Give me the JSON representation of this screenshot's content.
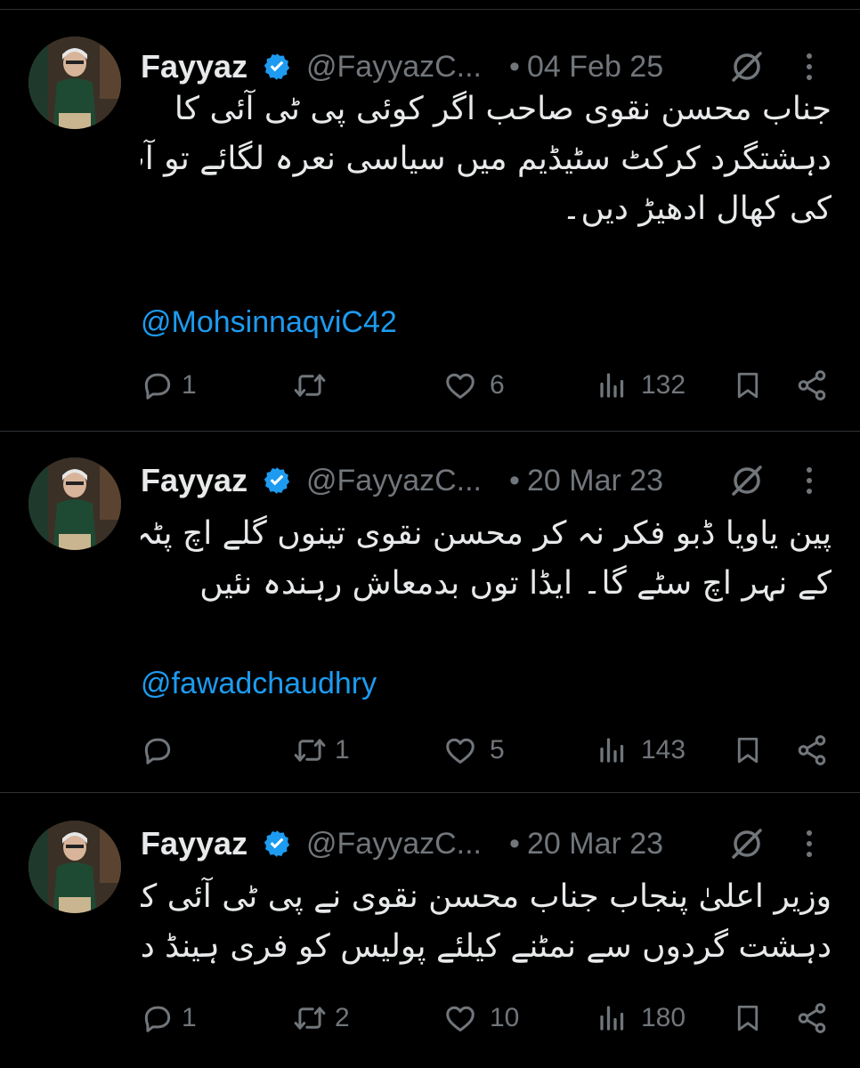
{
  "author": {
    "name": "Fayyaz",
    "handle": "@FayyazC...",
    "verified_color": "#1d9bf0"
  },
  "colors": {
    "background": "#000000",
    "text": "#e7e9ea",
    "muted": "#71767b",
    "link": "#1d9bf0"
  },
  "icons": [
    "verified-badge-icon",
    "grok-icon",
    "more-icon",
    "reply-icon",
    "retweet-icon",
    "like-icon",
    "views-icon",
    "bookmark-icon",
    "share-icon"
  ],
  "tweets": [
    {
      "date": "04 Feb 25",
      "dot": "•",
      "lines": [
        "جناب محسن نقوی صاحب اگر کوئی پی ٹی آئی کا",
        "دہشتگرد کرکٹ سٹیڈیم میں سیاسی نعرہ لگائے تو آپ اس",
        "کی کھال ادھیڑ دیں۔"
      ],
      "mention": "@MohsinnaqviC42",
      "replies": "1",
      "retweets": "",
      "likes": "6",
      "views": "132"
    },
    {
      "date": "20 Mar 23",
      "dot": "•",
      "lines": [
        "پین یاویا ڈبو فکر نہ کر محسن نقوی تینوں گلے اچ پٹہ پا",
        "کے نہر اچ سٹے گا۔ ایڈا توں بدمعاش رہندہ نئیں"
      ],
      "mention": "@fawadchaudhry",
      "replies": "",
      "retweets": "1",
      "likes": "5",
      "views": "143"
    },
    {
      "date": "20 Mar 23",
      "dot": "•",
      "lines": [
        "وزیر اعلیٰ پنجاب جناب محسن نقوی نے پی ٹی آئی کے",
        "دہشت گردوں سے نمٹنے کیلئے پولیس کو فری ہینڈ دے دیا۔"
      ],
      "mention": "",
      "replies": "1",
      "retweets": "2",
      "likes": "10",
      "views": "180"
    }
  ]
}
